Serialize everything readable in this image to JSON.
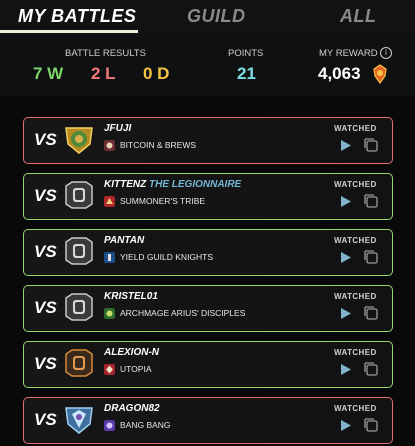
{
  "tabs": [
    {
      "label": "MY BATTLES",
      "active": true
    },
    {
      "label": "GUILD",
      "active": false
    },
    {
      "label": "ALL",
      "active": false
    }
  ],
  "summary": {
    "battle_results_label": "BATTLE RESULTS",
    "wins": "7 W",
    "losses": "2 L",
    "draws": "0 D",
    "points_label": "POINTS",
    "points": "21",
    "reward_label": "MY REWARD",
    "reward_value": "4,063",
    "reward_icon": "dec-coin-icon",
    "info_icon": "info-icon"
  },
  "colors": {
    "win": "#7ed66a",
    "loss": "#f2787a",
    "draw": "#f5c542",
    "points": "#7ee0e8",
    "win_border": "#8fd86a",
    "loss_border": "#e06d70"
  },
  "battles": [
    {
      "vs": "VS",
      "player": "JFUJI",
      "title": "",
      "guild": "BITCOIN & BREWS",
      "league_icon": "gold-league-icon",
      "guild_icon": "guild-crest-icon",
      "watched": "WATCHED",
      "result": "loss"
    },
    {
      "vs": "VS",
      "player": "KITTENZ",
      "title": "THE LEGIONNAIRE",
      "guild": "SUMMONER'S TRIBE",
      "league_icon": "silver-league-icon",
      "guild_icon": "guild-crest-icon",
      "watched": "WATCHED",
      "result": "win"
    },
    {
      "vs": "VS",
      "player": "PANTAN",
      "title": "",
      "guild": "YIELD GUILD KNIGHTS",
      "league_icon": "silver-league-icon",
      "guild_icon": "guild-crest-icon",
      "watched": "WATCHED",
      "result": "win"
    },
    {
      "vs": "VS",
      "player": "KRISTEL01",
      "title": "",
      "guild": "ARCHMAGE ARIUS' DISCIPLES",
      "league_icon": "silver-league-icon",
      "guild_icon": "guild-crest-icon",
      "watched": "WATCHED",
      "result": "win"
    },
    {
      "vs": "VS",
      "player": "ALEXION-N",
      "title": "",
      "guild": "UTOPIA",
      "league_icon": "bronze-league-icon",
      "guild_icon": "guild-crest-icon",
      "watched": "WATCHED",
      "result": "win"
    },
    {
      "vs": "VS",
      "player": "DRAGON82",
      "title": "",
      "guild": "BANG BANG",
      "league_icon": "diamond-league-icon",
      "guild_icon": "guild-crest-icon",
      "watched": "WATCHED",
      "result": "loss"
    }
  ]
}
